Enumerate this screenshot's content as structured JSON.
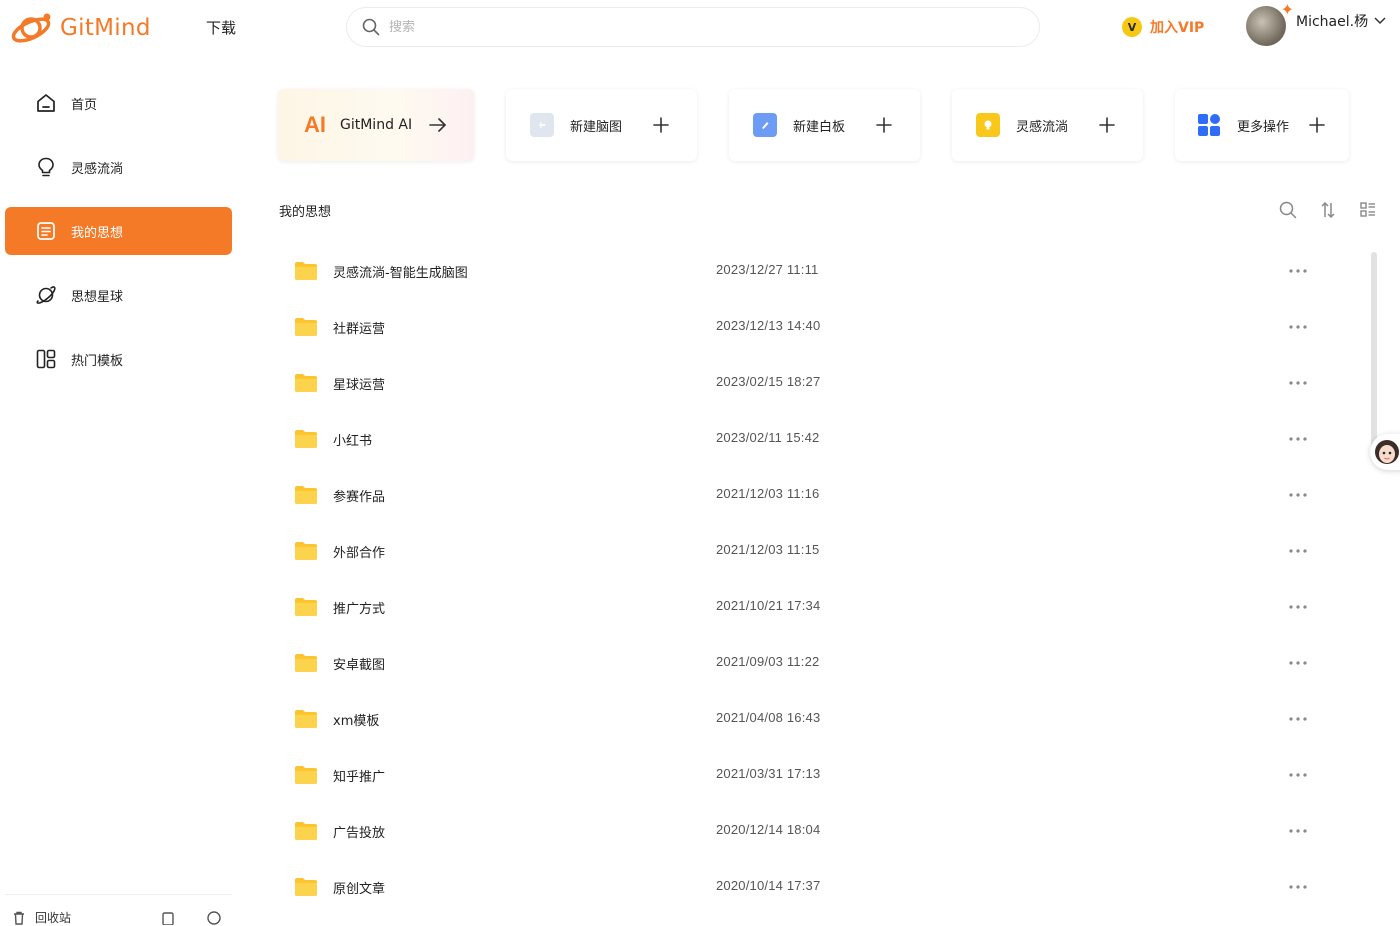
{
  "header": {
    "brand": "GitMind",
    "download_label": "下载",
    "search_placeholder": "搜索",
    "vip_badge": "V",
    "vip_label": "加入VIP",
    "user_name": "Michael.杨"
  },
  "sidebar": {
    "items": [
      {
        "label": "首页",
        "icon": "home-icon"
      },
      {
        "label": "灵感流淌",
        "icon": "lightbulb-icon"
      },
      {
        "label": "我的思想",
        "icon": "document-icon",
        "active": true
      },
      {
        "label": "思想星球",
        "icon": "planet-icon"
      },
      {
        "label": "热门模板",
        "icon": "template-icon"
      }
    ],
    "footer": {
      "trash_label": "回收站"
    }
  },
  "cards": {
    "ai": {
      "mark": "AI",
      "label": "GitMind AI"
    },
    "mindmap": {
      "label": "新建脑图"
    },
    "whiteboard": {
      "label": "新建白板"
    },
    "inspiration": {
      "label": "灵感流淌"
    },
    "more": {
      "label": "更多操作"
    }
  },
  "main": {
    "section_title": "我的思想",
    "folders": [
      {
        "name": "灵感流淌-智能生成脑图",
        "date": "2023/12/27 11:11"
      },
      {
        "name": "社群运营",
        "date": "2023/12/13 14:40"
      },
      {
        "name": "星球运营",
        "date": "2023/02/15 18:27"
      },
      {
        "name": "小红书",
        "date": "2023/02/11 15:42"
      },
      {
        "name": "参赛作品",
        "date": "2021/12/03 11:16"
      },
      {
        "name": "外部合作",
        "date": "2021/12/03 11:15"
      },
      {
        "name": "推广方式",
        "date": "2021/10/21 17:34"
      },
      {
        "name": "安卓截图",
        "date": "2021/09/03 11:22"
      },
      {
        "name": "xm模板",
        "date": "2021/04/08 16:43"
      },
      {
        "name": "知乎推广",
        "date": "2021/03/31 17:13"
      },
      {
        "name": "广告投放",
        "date": "2020/12/14 18:04"
      },
      {
        "name": "原创文章",
        "date": "2020/10/14 17:37"
      }
    ]
  },
  "colors": {
    "accent": "#f47a27",
    "folder": "#fcc52e",
    "vip": "#f6c814",
    "blue": "#2f6df6"
  }
}
